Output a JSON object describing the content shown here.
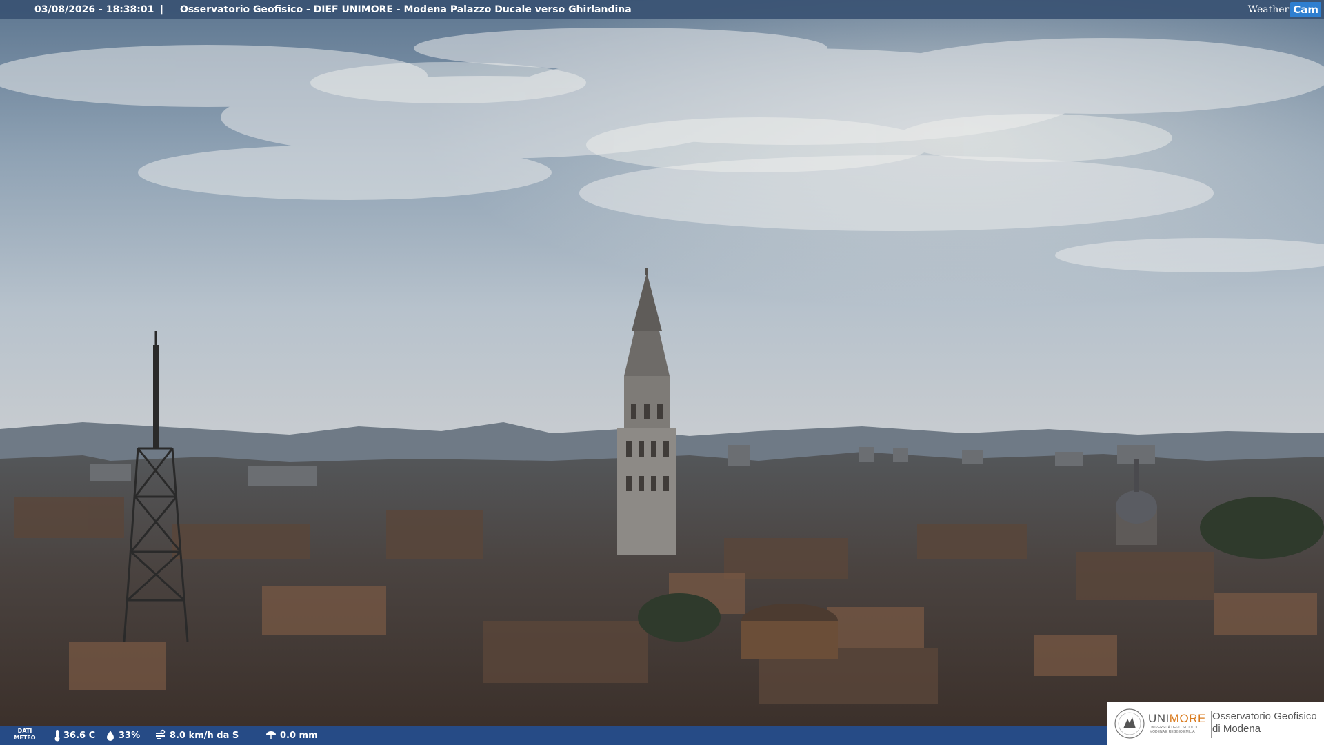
{
  "overlay": {
    "datetime": "03/08/2026 - 18:38:01",
    "separator": "|",
    "title": "Osservatorio Geofisico - DIEF UNIMORE - Modena Palazzo Ducale verso Ghirlandina",
    "brand_word": "Weather",
    "brand_cam": "Cam"
  },
  "weather": {
    "label_line1": "DATI",
    "label_line2": "METEO",
    "temperature": "36.6 C",
    "humidity": "33%",
    "wind": "8.0 km/h da S",
    "rain": "0.0 mm",
    "icons": [
      "thermometer-icon",
      "humidity-drop-icon",
      "wind-icon",
      "rain-gauge-icon"
    ]
  },
  "logo": {
    "uni_prefix": "UNI",
    "uni_suffix": "MORE",
    "uni_sub": "UNIVERSITÀ DEGLI STUDI DI MODENA E REGGIO EMILIA",
    "obs_line1": "Osservatorio Geofisico",
    "obs_line2": "di Modena"
  },
  "colors": {
    "topbar": "#3a5273",
    "bottombar": "#234f96",
    "unimore_accent": "#d97a1d"
  }
}
